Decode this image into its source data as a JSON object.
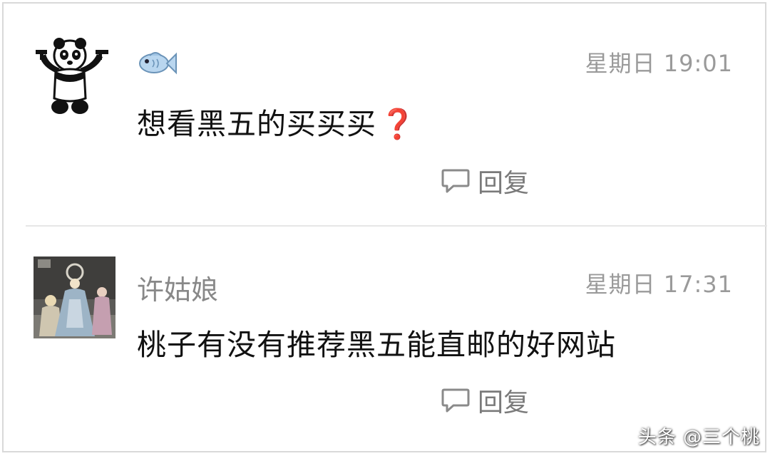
{
  "comments": [
    {
      "avatar": "panda-with-guns",
      "username_icon": "fish-emoji",
      "timestamp": "星期日 19:01",
      "text": "想看黑五的买买买",
      "text_suffix_icon": "question-mark-emoji",
      "reply_label": "回复"
    },
    {
      "avatar": "figurines-photo",
      "username": "许姑娘",
      "timestamp": "星期日 17:31",
      "text": "桃子有没有推荐黑五能直邮的好网站",
      "reply_label": "回复"
    }
  ],
  "watermark": "头条 @三个桃",
  "colors": {
    "question_mark": "#c8252b",
    "fish_body": "#b9d6ef",
    "username": "#888888",
    "timestamp": "#9a9a9a"
  }
}
